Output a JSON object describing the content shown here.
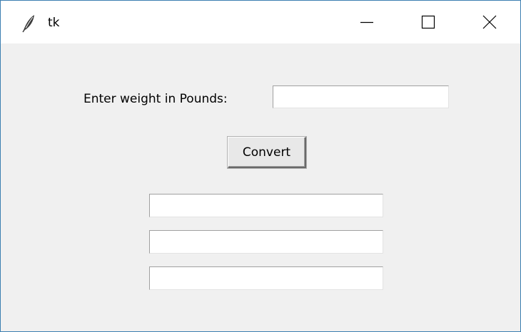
{
  "window": {
    "title": "tk",
    "icon": "feather-icon",
    "controls": {
      "minimize_icon": "minimize-icon",
      "maximize_icon": "maximize-icon",
      "close_icon": "close-icon"
    }
  },
  "form": {
    "weight_label": "Enter weight in Pounds:",
    "weight_value": "",
    "convert_label": "Convert",
    "results": [
      "",
      "",
      ""
    ]
  },
  "colors": {
    "window_border": "#3c7fb1",
    "client_background": "#f0f0f0",
    "titlebar_background": "#ffffff",
    "entry_background": "#ffffff"
  }
}
